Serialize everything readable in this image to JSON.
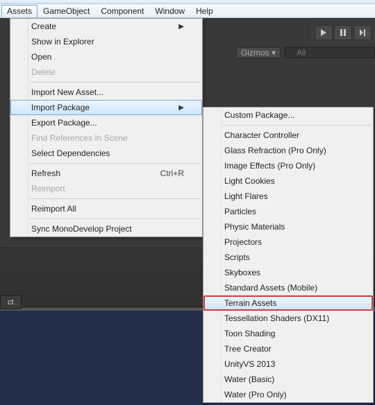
{
  "menubar": {
    "items": [
      "Assets",
      "GameObject",
      "Component",
      "Window",
      "Help"
    ],
    "open_index": 0
  },
  "toolbar": {
    "gizmos_label": "Gizmos",
    "search_placeholder": "All"
  },
  "panel": {
    "tab": "ct"
  },
  "dropdown_main": [
    {
      "label": "Create",
      "submenu": true
    },
    {
      "label": "Show in Explorer"
    },
    {
      "label": "Open"
    },
    {
      "label": "Delete",
      "disabled": true
    },
    {
      "sep": true
    },
    {
      "label": "Import New Asset..."
    },
    {
      "label": "Import Package",
      "submenu": true,
      "highlight": true
    },
    {
      "label": "Export Package..."
    },
    {
      "label": "Find References In Scene",
      "disabled": true
    },
    {
      "label": "Select Dependencies"
    },
    {
      "sep": true
    },
    {
      "label": "Refresh",
      "shortcut": "Ctrl+R"
    },
    {
      "label": "Reimport",
      "disabled": true
    },
    {
      "sep": true
    },
    {
      "label": "Reimport All"
    },
    {
      "sep": true
    },
    {
      "label": "Sync MonoDevelop Project"
    }
  ],
  "dropdown_sub": [
    {
      "label": "Custom Package..."
    },
    {
      "sep": true
    },
    {
      "label": "Character Controller"
    },
    {
      "label": "Glass Refraction (Pro Only)"
    },
    {
      "label": "Image Effects (Pro Only)"
    },
    {
      "label": "Light Cookies"
    },
    {
      "label": "Light Flares"
    },
    {
      "label": "Particles"
    },
    {
      "label": "Physic Materials"
    },
    {
      "label": "Projectors"
    },
    {
      "label": "Scripts"
    },
    {
      "label": "Skyboxes"
    },
    {
      "label": "Standard Assets (Mobile)"
    },
    {
      "label": "Terrain Assets",
      "highlight": true,
      "red": true
    },
    {
      "label": "Tessellation Shaders (DX11)"
    },
    {
      "label": "Toon Shading"
    },
    {
      "label": "Tree Creator"
    },
    {
      "label": "UnityVS 2013"
    },
    {
      "label": "Water (Basic)"
    },
    {
      "label": "Water (Pro Only)"
    }
  ]
}
